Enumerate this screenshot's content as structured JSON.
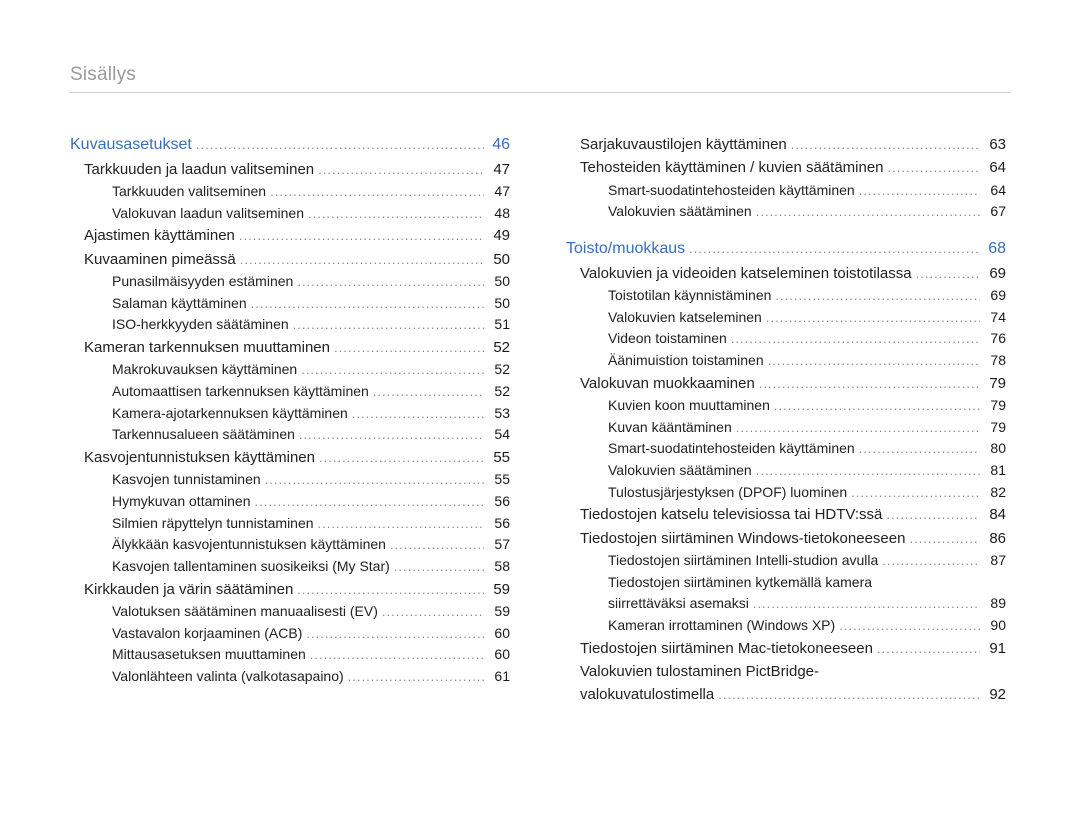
{
  "running_head": "Sisällys",
  "left_column": [
    {
      "level": "section",
      "label": "Kuvausasetukset",
      "page": "46"
    },
    {
      "level": "l1",
      "label": "Tarkkuuden ja laadun valitseminen",
      "page": "47"
    },
    {
      "level": "l2",
      "label": "Tarkkuuden valitseminen",
      "page": "47"
    },
    {
      "level": "l2",
      "label": "Valokuvan laadun valitseminen",
      "page": "48"
    },
    {
      "level": "l1",
      "label": "Ajastimen käyttäminen",
      "page": "49"
    },
    {
      "level": "l1",
      "label": "Kuvaaminen pimeässä",
      "page": "50"
    },
    {
      "level": "l2",
      "label": "Punasilmäisyyden estäminen",
      "page": "50"
    },
    {
      "level": "l2",
      "label": "Salaman käyttäminen",
      "page": "50"
    },
    {
      "level": "l2",
      "label": "ISO-herkkyyden säätäminen",
      "page": "51"
    },
    {
      "level": "l1",
      "label": "Kameran tarkennuksen muuttaminen",
      "page": "52"
    },
    {
      "level": "l2",
      "label": "Makrokuvauksen käyttäminen",
      "page": "52"
    },
    {
      "level": "l2",
      "label": "Automaattisen tarkennuksen käyttäminen",
      "page": "52"
    },
    {
      "level": "l2",
      "label": "Kamera-ajotarkennuksen käyttäminen",
      "page": "53"
    },
    {
      "level": "l2",
      "label": "Tarkennusalueen säätäminen",
      "page": "54"
    },
    {
      "level": "l1",
      "label": "Kasvojentunnistuksen käyttäminen",
      "page": "55"
    },
    {
      "level": "l2",
      "label": "Kasvojen tunnistaminen",
      "page": "55"
    },
    {
      "level": "l2",
      "label": "Hymykuvan ottaminen",
      "page": "56"
    },
    {
      "level": "l2",
      "label": "Silmien räpyttelyn tunnistaminen",
      "page": "56"
    },
    {
      "level": "l2",
      "label": "Älykkään kasvojentunnistuksen käyttäminen",
      "page": "57"
    },
    {
      "level": "l2",
      "label": "Kasvojen tallentaminen suosikeiksi (My Star)",
      "page": "58"
    },
    {
      "level": "l1",
      "label": "Kirkkauden ja värin säätäminen",
      "page": "59"
    },
    {
      "level": "l2",
      "label": "Valotuksen säätäminen manuaalisesti (EV)",
      "page": "59"
    },
    {
      "level": "l2",
      "label": "Vastavalon korjaaminen (ACB)",
      "page": "60"
    },
    {
      "level": "l2",
      "label": "Mittausasetuksen muuttaminen",
      "page": "60"
    },
    {
      "level": "l2",
      "label": "Valonlähteen valinta (valkotasapaino)",
      "page": "61"
    }
  ],
  "right_column": [
    {
      "level": "l1",
      "label": "Sarjakuvaustilojen käyttäminen",
      "page": "63"
    },
    {
      "level": "l1",
      "label": "Tehosteiden käyttäminen / kuvien säätäminen",
      "page": "64"
    },
    {
      "level": "l2",
      "label": "Smart-suodatintehosteiden käyttäminen",
      "page": "64"
    },
    {
      "level": "l2",
      "label": "Valokuvien säätäminen",
      "page": "67"
    },
    {
      "level": "spacer"
    },
    {
      "level": "section",
      "label": "Toisto/muokkaus",
      "page": "68"
    },
    {
      "level": "l1",
      "label": "Valokuvien ja videoiden katseleminen toistotilassa",
      "page": "69"
    },
    {
      "level": "l2",
      "label": "Toistotilan käynnistäminen",
      "page": "69"
    },
    {
      "level": "l2",
      "label": "Valokuvien katseleminen",
      "page": "74"
    },
    {
      "level": "l2",
      "label": "Videon toistaminen",
      "page": "76"
    },
    {
      "level": "l2",
      "label": "Äänimuistion toistaminen",
      "page": "78"
    },
    {
      "level": "l1",
      "label": "Valokuvan muokkaaminen",
      "page": "79"
    },
    {
      "level": "l2",
      "label": "Kuvien koon muuttaminen",
      "page": "79"
    },
    {
      "level": "l2",
      "label": "Kuvan kääntäminen",
      "page": "79"
    },
    {
      "level": "l2",
      "label": "Smart-suodatintehosteiden käyttäminen",
      "page": "80"
    },
    {
      "level": "l2",
      "label": "Valokuvien säätäminen",
      "page": "81"
    },
    {
      "level": "l2",
      "label": "Tulostusjärjestyksen (DPOF) luominen",
      "page": "82"
    },
    {
      "level": "l1",
      "label": "Tiedostojen katselu televisiossa tai HDTV:ssä",
      "page": "84"
    },
    {
      "level": "l1",
      "label": "Tiedostojen siirtäminen Windows-tietokoneeseen",
      "page": "86"
    },
    {
      "level": "l2",
      "label": "Tiedostojen siirtäminen Intelli-studion avulla",
      "page": "87"
    },
    {
      "level": "l2-multi",
      "label1": "Tiedostojen siirtäminen kytkemällä kamera",
      "label2": "siirrettäväksi asemaksi",
      "page": "89"
    },
    {
      "level": "l2",
      "label": "Kameran irrottaminen (Windows XP)",
      "page": "90"
    },
    {
      "level": "l1",
      "label": "Tiedostojen siirtäminen Mac-tietokoneeseen",
      "page": "91"
    },
    {
      "level": "l1-multi",
      "label1": "Valokuvien tulostaminen PictBridge-",
      "label2": "valokuvatulostimella",
      "page": "92"
    }
  ]
}
